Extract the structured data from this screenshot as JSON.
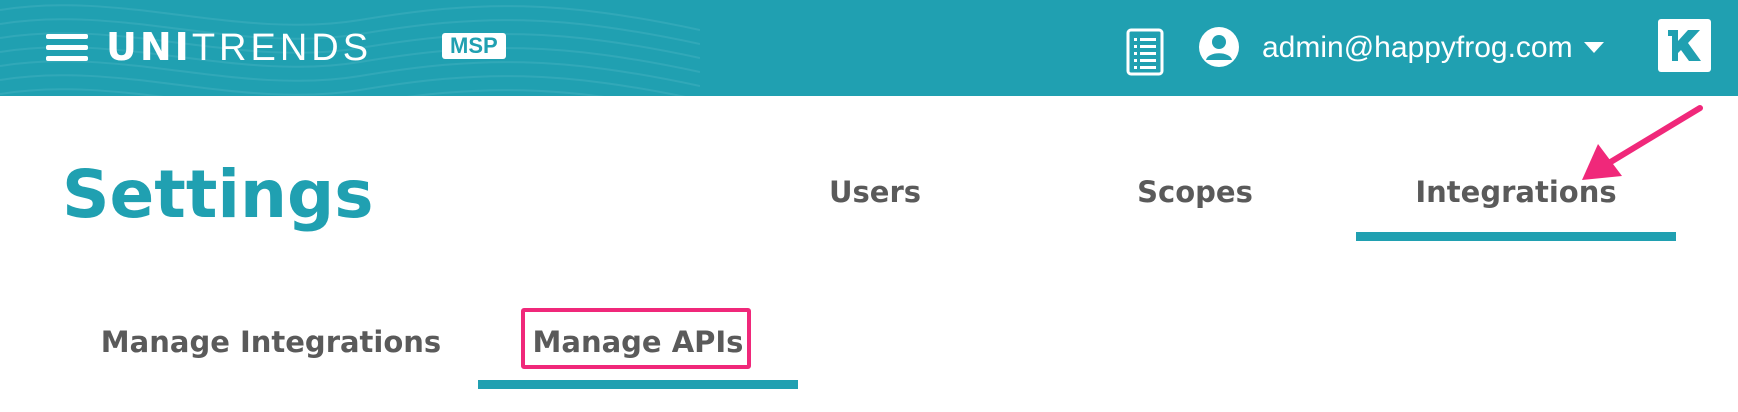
{
  "header": {
    "brand_bold": "UNI",
    "brand_light": "TRENDS",
    "badge": "MSP",
    "account_email": "admin@happyfrog.com",
    "icons": [
      "menu-icon",
      "document-list-icon",
      "account-circle-icon",
      "caret-down-icon",
      "kaseya-k-logo"
    ],
    "accent_color": "#20a0b1"
  },
  "page": {
    "title": "Settings"
  },
  "tabs": [
    {
      "label": "Users",
      "active": false
    },
    {
      "label": "Scopes",
      "active": false
    },
    {
      "label": "Integrations",
      "active": true
    }
  ],
  "subtabs": [
    {
      "label": "Manage Integrations",
      "active": false
    },
    {
      "label": "Manage APIs",
      "active": true
    }
  ],
  "annotation": {
    "highlight_color": "#f0287a"
  }
}
